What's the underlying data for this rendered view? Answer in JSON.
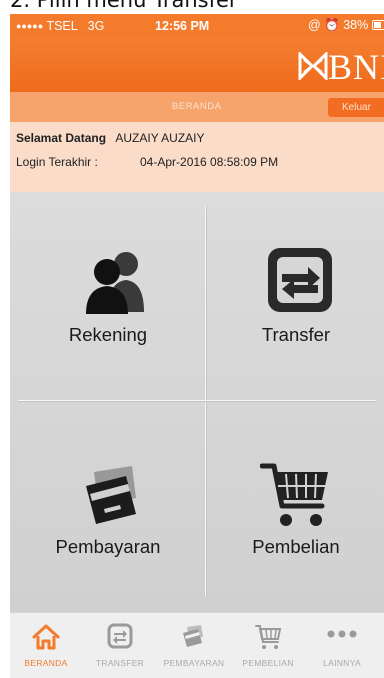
{
  "caption": "2. Pilih menu Transfer",
  "status": {
    "dots": "●●●●●",
    "carrier": "TSEL",
    "network": "3G",
    "time": "12:56 PM",
    "extra": "@ ⏰",
    "battery": "38%"
  },
  "brand": {
    "logo_text": "BNI"
  },
  "nav": {
    "home_label": "BERANDA",
    "logout_label": "Keluar"
  },
  "welcome": {
    "greeting_label": "Selamat Datang",
    "user_name": "AUZAIY AUZAIY",
    "last_login_label": "Login Terakhir :",
    "last_login_value": "04-Apr-2016 08:58:09 PM"
  },
  "menu": {
    "rekening": "Rekening",
    "transfer": "Transfer",
    "pembayaran": "Pembayaran",
    "pembelian": "Pembelian"
  },
  "tabs": {
    "beranda": "BERANDA",
    "transfer": "TRANSFER",
    "pembayaran": "PEMBAYARAN",
    "pembelian": "PEMBELIAN",
    "lainnya": "LAINNYA"
  },
  "colors": {
    "accent": "#f47b2b",
    "header": "#ef6a1c",
    "nav": "#f7a36c",
    "welcome": "#fbdcc9"
  },
  "icons": [
    "users-icon",
    "transfer-icon",
    "card-icon",
    "cart-icon",
    "home-icon",
    "more-icon"
  ]
}
